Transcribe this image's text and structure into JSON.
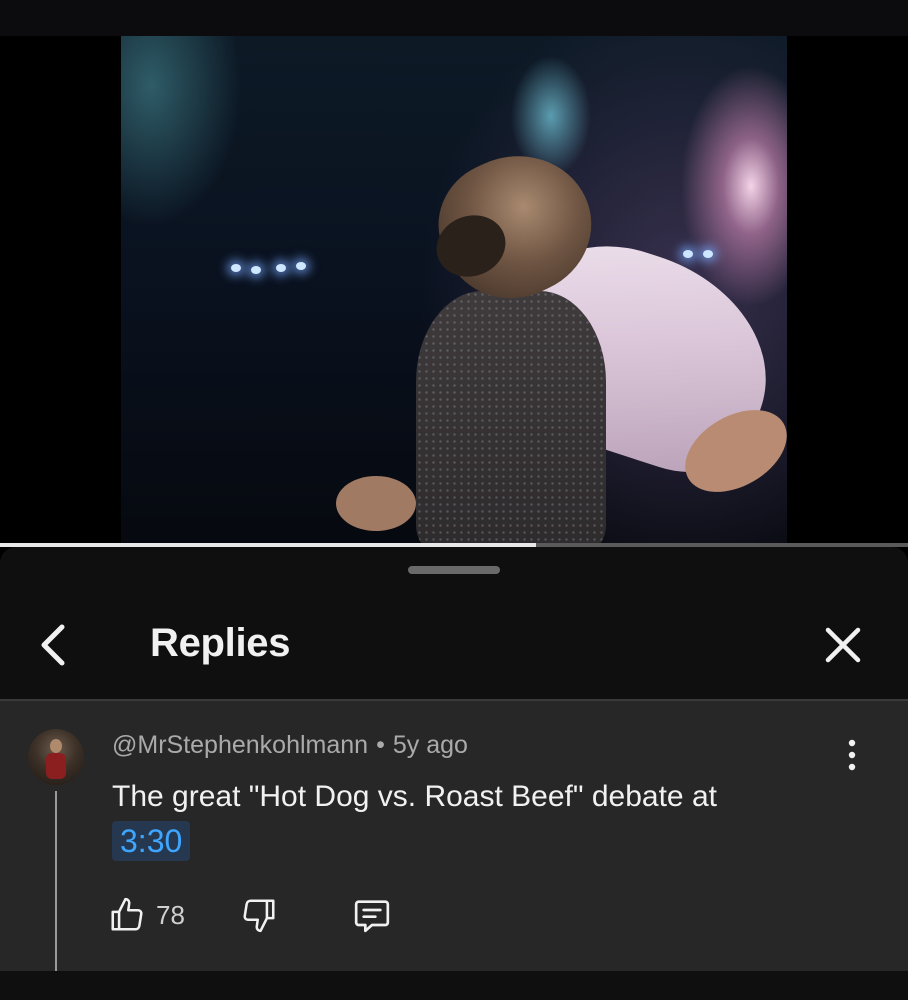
{
  "video": {
    "progress_fraction": 0.59
  },
  "header": {
    "title": "Replies",
    "back_icon": "chevron-left-icon",
    "close_icon": "close-icon"
  },
  "comment": {
    "author": "@MrStephenkohlmann",
    "separator": "•",
    "age": "5y ago",
    "text": "The great \"Hot Dog vs. Roast Beef\" debate at",
    "timestamp": "3:30",
    "like_count": "78",
    "icons": [
      "thumbs-up-icon",
      "thumbs-down-icon",
      "reply-icon",
      "more-vertical-icon"
    ]
  },
  "colors": {
    "sheet_bg": "#0f0f0f",
    "comment_bg": "#272727",
    "link_blue": "#3ea6ff",
    "text_primary": "#f1f1f1",
    "text_secondary": "#aaaaaa"
  }
}
